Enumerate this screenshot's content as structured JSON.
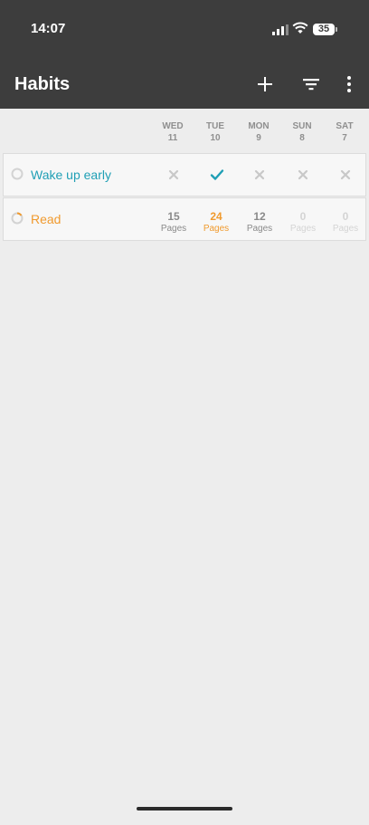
{
  "status_bar": {
    "time": "14:07",
    "battery": "35"
  },
  "app_bar": {
    "title": "Habits",
    "actions": [
      "add-icon",
      "filter-icon",
      "more-vert-icon"
    ]
  },
  "days": [
    {
      "dow": "WED",
      "date": "11"
    },
    {
      "dow": "TUE",
      "date": "10"
    },
    {
      "dow": "MON",
      "date": "9"
    },
    {
      "dow": "SUN",
      "date": "8"
    },
    {
      "dow": "SAT",
      "date": "7"
    }
  ],
  "habits": [
    {
      "name": "Wake up early",
      "color": "#1f9fb5",
      "type": "boolean",
      "values": [
        "missed",
        "done",
        "missed",
        "missed",
        "missed"
      ]
    },
    {
      "name": "Read",
      "color": "#f09a2e",
      "type": "numeric",
      "unit": "Pages",
      "values": [
        "15",
        "24",
        "12",
        "0",
        "0"
      ]
    }
  ],
  "colors": {
    "toolbar": "#3d3d3d",
    "background": "#ededed",
    "teal": "#1f9fb5",
    "orange": "#f09a2e"
  }
}
